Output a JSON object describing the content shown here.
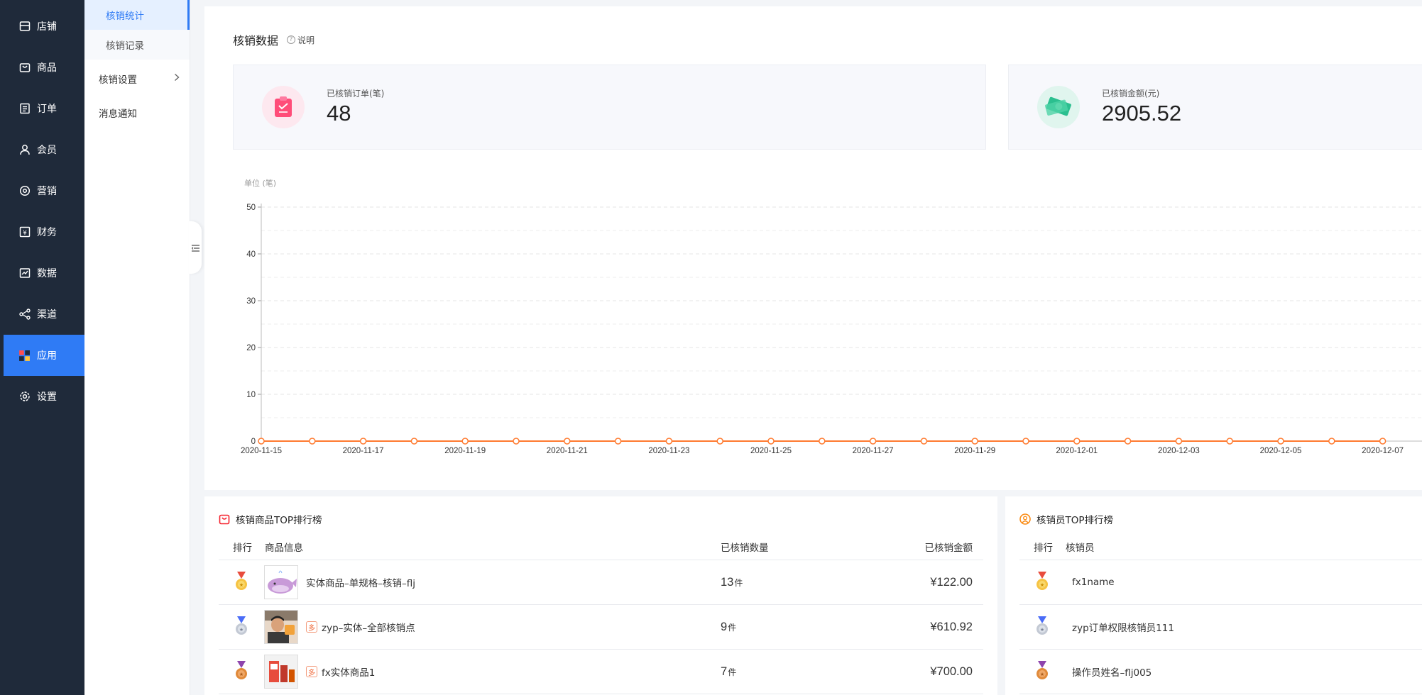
{
  "nav": {
    "items": [
      {
        "label": "店铺",
        "icon": "store-icon"
      },
      {
        "label": "商品",
        "icon": "bag-icon"
      },
      {
        "label": "订单",
        "icon": "order-icon"
      },
      {
        "label": "会员",
        "icon": "user-icon"
      },
      {
        "label": "营销",
        "icon": "marketing-icon"
      },
      {
        "label": "财务",
        "icon": "finance-icon"
      },
      {
        "label": "数据",
        "icon": "chart-icon"
      },
      {
        "label": "渠道",
        "icon": "share-icon"
      },
      {
        "label": "应用",
        "icon": "apps-icon"
      },
      {
        "label": "设置",
        "icon": "gear-icon"
      }
    ],
    "active_index": 8
  },
  "subnav": {
    "items": [
      {
        "label": "核销统计"
      },
      {
        "label": "核销记录"
      },
      {
        "label": "核销设置"
      },
      {
        "label": "消息通知"
      }
    ]
  },
  "section": {
    "title": "核销数据",
    "help_label": "说明"
  },
  "stats": [
    {
      "label": "已核销订单(笔)",
      "value": "48",
      "icon": "order-clipboard-icon",
      "color": "#ff4d79"
    },
    {
      "label": "已核销金额(元)",
      "value": "2905.52",
      "icon": "money-icon",
      "color": "#2bbf8f"
    }
  ],
  "chart_data": {
    "type": "line",
    "ylabel": "单位 (笔)",
    "ylim": [
      0,
      50
    ],
    "yticks": [
      0,
      10,
      20,
      30,
      40,
      50
    ],
    "x_tick_labels": [
      "2020-11-15",
      "2020-11-17",
      "2020-11-19",
      "2020-11-21",
      "2020-11-23",
      "2020-11-25",
      "2020-11-27",
      "2020-11-29",
      "2020-12-01",
      "2020-12-03",
      "2020-12-05",
      "2020-12-07"
    ],
    "x": [
      "2020-11-15",
      "2020-11-16",
      "2020-11-17",
      "2020-11-18",
      "2020-11-19",
      "2020-11-20",
      "2020-11-21",
      "2020-11-22",
      "2020-11-23",
      "2020-11-24",
      "2020-11-25",
      "2020-11-26",
      "2020-11-27",
      "2020-11-28",
      "2020-11-29",
      "2020-11-30",
      "2020-12-01",
      "2020-12-02",
      "2020-12-03",
      "2020-12-04",
      "2020-12-05",
      "2020-12-06",
      "2020-12-07"
    ],
    "series": [
      {
        "values": [
          0,
          0,
          0,
          0,
          0,
          0,
          0,
          0,
          0,
          0,
          0,
          0,
          0,
          0,
          0,
          0,
          0,
          0,
          0,
          0,
          0,
          0,
          0
        ],
        "color": "#ff7a2f"
      }
    ],
    "grid": true
  },
  "products_rank": {
    "title": "核销商品TOP排行榜",
    "headers": {
      "rank": "排行",
      "info": "商品信息",
      "qty": "已核销数量",
      "amount": "已核销金额"
    },
    "rows": [
      {
        "name": "实体商品–单规格–核销–flj",
        "multi": "",
        "qty": "13",
        "unit": "件",
        "amount": "¥122.00"
      },
      {
        "name": "zyp–实体–全部核销点",
        "multi": "多",
        "qty": "9",
        "unit": "件",
        "amount": "¥610.92"
      },
      {
        "name": "fx实体商品1",
        "multi": "多",
        "qty": "7",
        "unit": "件",
        "amount": "¥700.00"
      }
    ]
  },
  "staff_rank": {
    "title": "核销员TOP排行榜",
    "headers": {
      "rank": "排行",
      "name": "核销员"
    },
    "rows": [
      {
        "name": "fx1name"
      },
      {
        "name": "zyp订单权限核销员111"
      },
      {
        "name": "操作员姓名–flj005"
      }
    ]
  }
}
